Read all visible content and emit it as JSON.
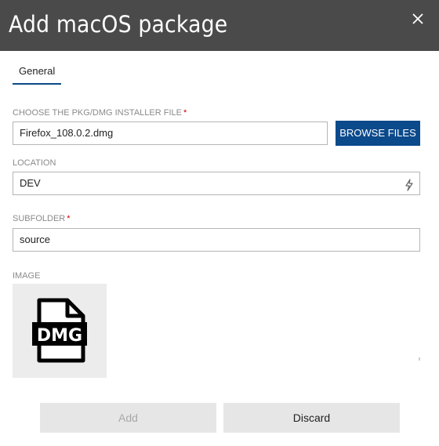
{
  "header": {
    "title": "Add macOS package",
    "close_icon": "close-icon"
  },
  "tabs": [
    {
      "label": "General"
    }
  ],
  "fields": {
    "installer": {
      "label": "CHOOSE THE PKG/DMG INSTALLER FILE",
      "required_mark": "*",
      "value": "Firefox_108.0.2.dmg",
      "browse_label": "BROWSE FILES"
    },
    "location": {
      "label": "LOCATION",
      "value": "DEV",
      "icon": "lightning-bolt-icon"
    },
    "subfolder": {
      "label": "SUBFOLDER",
      "required_mark": "*",
      "value": "source"
    },
    "image": {
      "label": "IMAGE",
      "icon_text": "DMG"
    }
  },
  "actions": {
    "add_label": "Add",
    "discard_label": "Discard"
  },
  "colors": {
    "header_bg": "#4a4a4a",
    "accent": "#0b4a8b",
    "required": "#d00000",
    "button_bg": "#e6e6e6"
  }
}
